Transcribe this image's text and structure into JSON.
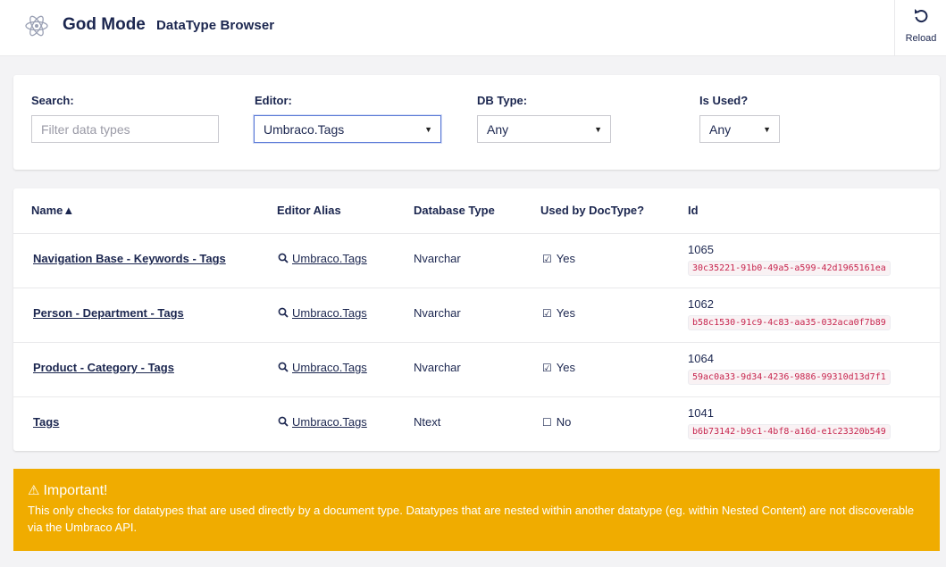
{
  "header": {
    "app_title": "God Mode",
    "sub_title": "DataType Browser",
    "logo_icon": "atom-icon",
    "reload_label": "Reload",
    "reload_icon": "reload-icon"
  },
  "filters": {
    "search_label": "Search:",
    "search_placeholder": "Filter data types",
    "editor_label": "Editor:",
    "editor_value": "Umbraco.Tags",
    "dbtype_label": "DB Type:",
    "dbtype_value": "Any",
    "isused_label": "Is Used?",
    "isused_value": "Any"
  },
  "table": {
    "headers": {
      "name": "Name▲",
      "alias": "Editor Alias",
      "dbtype": "Database Type",
      "used": "Used by DocType?",
      "id": "Id"
    },
    "rows": [
      {
        "name": "Navigation Base - Keywords - Tags",
        "alias": "Umbraco.Tags",
        "dbtype": "Nvarchar",
        "used_mark": "☑",
        "used": "Yes",
        "id": "1065",
        "guid": "30c35221-91b0-49a5-a599-42d1965161ea"
      },
      {
        "name": "Person - Department - Tags",
        "alias": "Umbraco.Tags",
        "dbtype": "Nvarchar",
        "used_mark": "☑",
        "used": "Yes",
        "id": "1062",
        "guid": "b58c1530-91c9-4c83-aa35-032aca0f7b89"
      },
      {
        "name": "Product - Category - Tags",
        "alias": "Umbraco.Tags",
        "dbtype": "Nvarchar",
        "used_mark": "☑",
        "used": "Yes",
        "id": "1064",
        "guid": "59ac0a33-9d34-4236-9886-99310d13d7f1"
      },
      {
        "name": "Tags",
        "alias": "Umbraco.Tags",
        "dbtype": "Ntext",
        "used_mark": "☐",
        "used": "No",
        "id": "1041",
        "guid": "b6b73142-b9c1-4bf8-a16d-e1c23320b549"
      }
    ]
  },
  "alert": {
    "icon": "warning-icon",
    "title": "Important!",
    "body": "This only checks for datatypes that are used directly by a document type. Datatypes that are nested within another datatype (eg. within Nested Content) are not discoverable via the Umbraco API.",
    "color": "#f0ac00"
  }
}
